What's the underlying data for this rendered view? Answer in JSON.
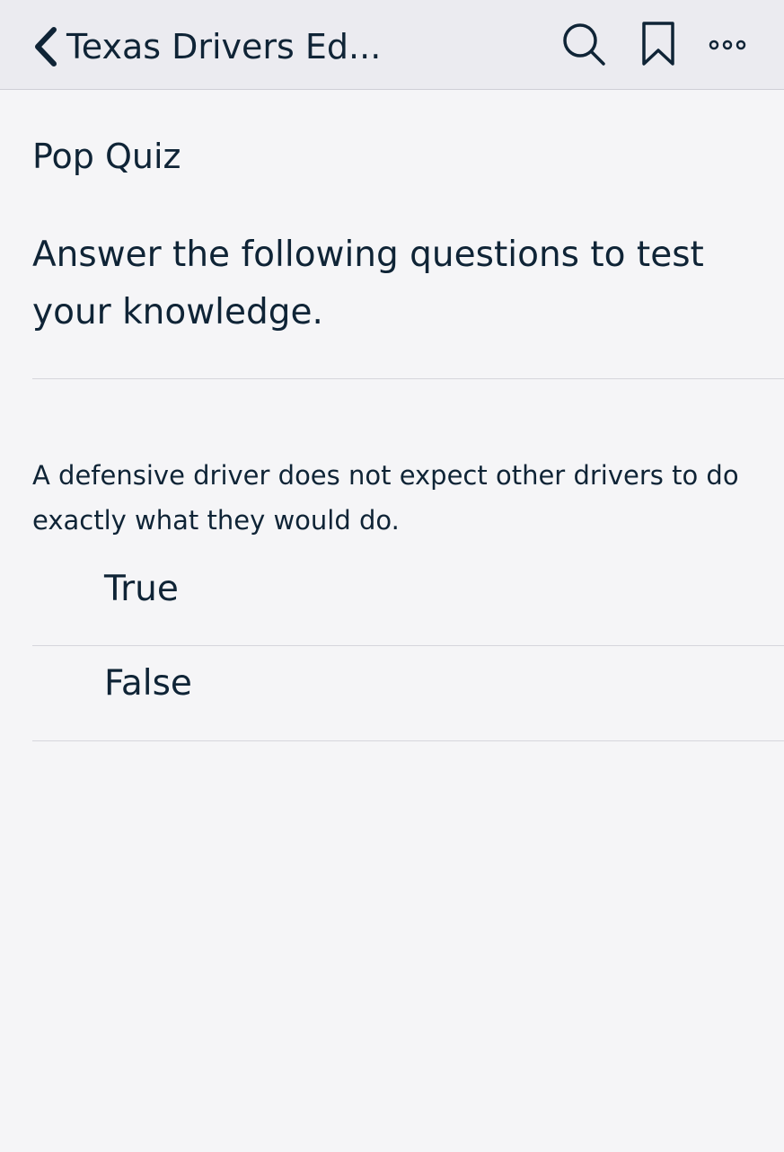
{
  "colors": {
    "navbar_bg": "#ebebf0",
    "page_bg": "#f5f5f7",
    "text": "#0f2436",
    "divider": "#d6d6dc"
  },
  "navbar": {
    "back_icon": "chevron-left-icon",
    "title": "Texas Drivers Ed...",
    "actions": [
      {
        "name": "search",
        "icon": "search-icon"
      },
      {
        "name": "bookmark",
        "icon": "bookmark-icon"
      },
      {
        "name": "more",
        "icon": "more-horizontal-icon"
      }
    ]
  },
  "quiz": {
    "title": "Pop Quiz",
    "intro": "Answer the following questions to test your knowledge.",
    "question": "A defensive driver does not expect other drivers to do exactly what they would do.",
    "options": [
      {
        "label": "True"
      },
      {
        "label": "False"
      }
    ]
  }
}
